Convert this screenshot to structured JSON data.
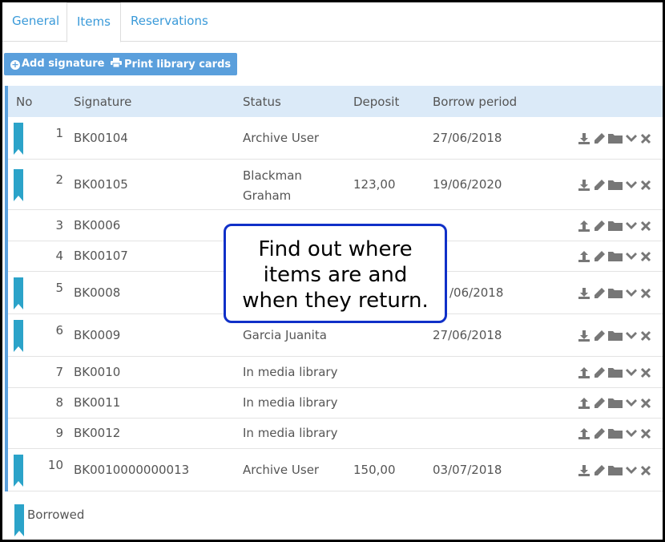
{
  "tabs": [
    {
      "label": "General"
    },
    {
      "label": "Items"
    },
    {
      "label": "Reservations"
    }
  ],
  "toolbar": {
    "add_signature_label": "Add signature",
    "print_cards_label": "Print library cards"
  },
  "table": {
    "headers": {
      "no": "No",
      "signature": "Signature",
      "status": "Status",
      "deposit": "Deposit",
      "borrow_period": "Borrow period"
    },
    "rows": [
      {
        "no": "1",
        "signature": "BK00104",
        "status": "Archive User",
        "status_line2": "",
        "deposit": "",
        "borrow_period": "27/06/2018",
        "borrowed": true,
        "action": "download"
      },
      {
        "no": "2",
        "signature": "BK00105",
        "status": "Blackman",
        "status_line2": "Graham",
        "deposit": "123,00",
        "borrow_period": "19/06/2020",
        "borrowed": true,
        "action": "download"
      },
      {
        "no": "3",
        "signature": "BK0006",
        "status": "",
        "status_line2": "",
        "deposit": "",
        "borrow_period": "",
        "borrowed": false,
        "action": "upload"
      },
      {
        "no": "4",
        "signature": "BK00107",
        "status": "",
        "status_line2": "",
        "deposit": "",
        "borrow_period": "",
        "borrowed": false,
        "action": "upload"
      },
      {
        "no": "5",
        "signature": "BK0008",
        "status": "",
        "status_line2": "",
        "deposit": "",
        "borrow_period": "/06/2018",
        "borrowed": true,
        "action": "download"
      },
      {
        "no": "6",
        "signature": "BK0009",
        "status": "Garcia Juanita",
        "status_line2": "",
        "deposit": "",
        "borrow_period": "27/06/2018",
        "borrowed": true,
        "action": "download"
      },
      {
        "no": "7",
        "signature": "BK0010",
        "status": "In media library",
        "status_line2": "",
        "deposit": "",
        "borrow_period": "",
        "borrowed": false,
        "action": "upload"
      },
      {
        "no": "8",
        "signature": "BK0011",
        "status": "In media library",
        "status_line2": "",
        "deposit": "",
        "borrow_period": "",
        "borrowed": false,
        "action": "upload"
      },
      {
        "no": "9",
        "signature": "BK0012",
        "status": "In media library",
        "status_line2": "",
        "deposit": "",
        "borrow_period": "",
        "borrowed": false,
        "action": "upload"
      },
      {
        "no": "10",
        "signature": "BK0010000000013",
        "status": "Archive User",
        "status_line2": "",
        "deposit": "150,00",
        "borrow_period": "03/07/2018",
        "borrowed": true,
        "action": "download"
      }
    ]
  },
  "legend": {
    "borrowed_label": "Borrowed"
  },
  "callout": {
    "line1": "Find out where",
    "line2": "items are and",
    "line3": "when they return."
  },
  "colors": {
    "accent": "#5a9fdc",
    "bookmark": "#2ba3c9",
    "header_bg": "#dbeaf8",
    "link": "#3a9ad9",
    "icon": "#777777",
    "callout_border": "#1030c8"
  },
  "icons": {
    "add": "plus-circle-icon",
    "print": "print-icon",
    "download": "download-icon",
    "upload": "upload-icon",
    "edit": "pencil-icon",
    "folder": "folder-icon",
    "expand": "chevron-down-icon",
    "delete": "close-icon",
    "borrowed": "bookmark-icon"
  }
}
